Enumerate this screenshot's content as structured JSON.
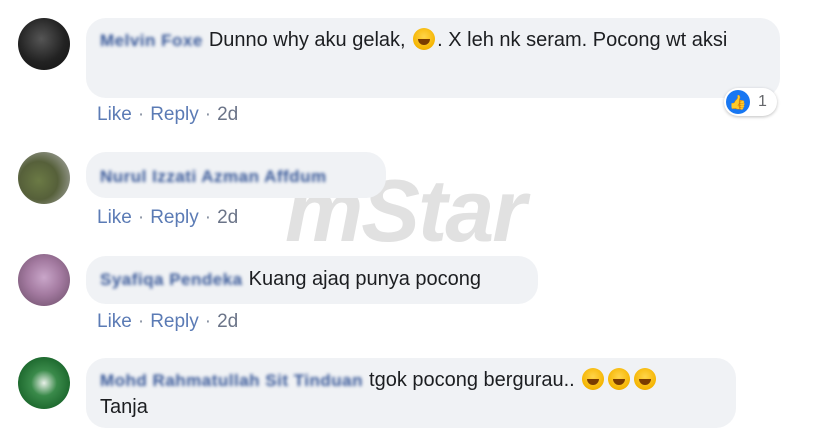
{
  "comments": [
    {
      "author": "Melvin Foxe",
      "text_before": "Dunno why aku gelak, ",
      "text_after": ". X leh nk seram. Pocong wt aksi",
      "actions": {
        "like": "Like",
        "reply": "Reply",
        "time": "2d"
      },
      "reaction_count": "1"
    },
    {
      "author": "Nurul Izzati Azman Affdum",
      "actions": {
        "like": "Like",
        "reply": "Reply",
        "time": "2d"
      }
    },
    {
      "author": "Syafiqa Pendeka",
      "text": "Kuang ajaq punya pocong",
      "actions": {
        "like": "Like",
        "reply": "Reply",
        "time": "2d"
      }
    },
    {
      "author": "Mohd Rahmatullah Sit Tinduan",
      "text": "tgok pocong bergurau..",
      "text_line2": "Tanja"
    }
  ],
  "watermark": "mStar",
  "icons": {
    "like_badge": "thumbs-up-icon",
    "emoji": "laughing-face-icon"
  },
  "colors": {
    "link": "#385898",
    "bubble": "#f0f2f5",
    "like_badge": "#1877f2"
  }
}
